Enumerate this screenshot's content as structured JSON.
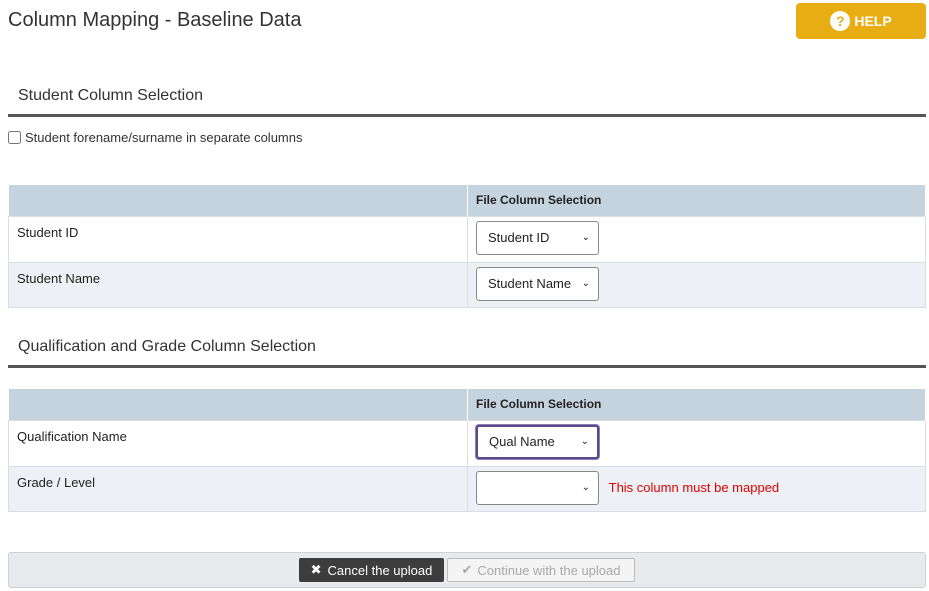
{
  "header": {
    "title": "Column Mapping - Baseline Data",
    "help_label": "HELP",
    "help_icon": "question-circle-icon"
  },
  "student_section": {
    "title": "Student Column Selection",
    "checkbox_label": "Student forename/surname in separate columns",
    "checkbox_checked": false,
    "table_header": "File Column Selection",
    "rows": [
      {
        "label": "Student ID",
        "selected": "Student ID"
      },
      {
        "label": "Student Name",
        "selected": "Student Name"
      }
    ]
  },
  "qual_section": {
    "title": "Qualification and Grade Column Selection",
    "table_header": "File Column Selection",
    "rows": [
      {
        "label": "Qualification Name",
        "selected": "Qual Name"
      },
      {
        "label": "Grade / Level",
        "selected": "",
        "error": "This column must be mapped"
      }
    ]
  },
  "footer": {
    "cancel_label": "Cancel the upload",
    "continue_label": "Continue with the upload"
  },
  "colors": {
    "help_button": "#e8ad13",
    "table_header_bg": "#c5d3de",
    "error_text": "#e00000",
    "cancel_button": "#3d3d3d"
  }
}
